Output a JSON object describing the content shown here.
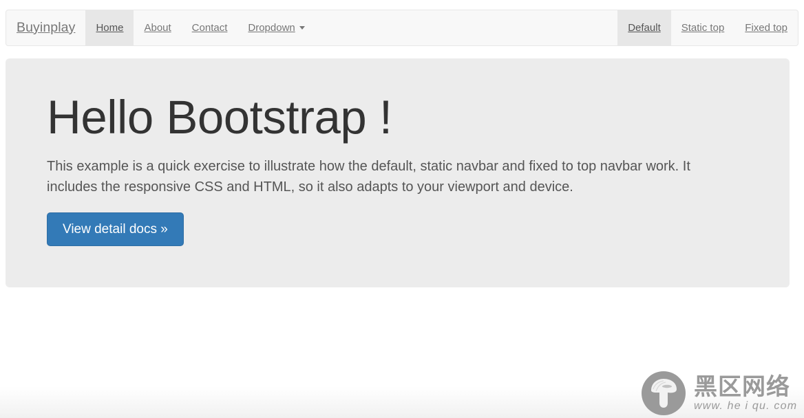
{
  "navbar": {
    "brand": "Buyinplay",
    "left_items": [
      {
        "label": "Home",
        "active": true,
        "caret": false
      },
      {
        "label": "About",
        "active": false,
        "caret": false
      },
      {
        "label": "Contact",
        "active": false,
        "caret": false
      },
      {
        "label": "Dropdown",
        "active": false,
        "caret": true
      }
    ],
    "right_items": [
      {
        "label": "Default",
        "active": true
      },
      {
        "label": "Static top",
        "active": false
      },
      {
        "label": "Fixed top",
        "active": false
      }
    ]
  },
  "jumbotron": {
    "heading": "Hello Bootstrap !",
    "paragraph": "This example is a quick exercise to illustrate how the default, static navbar and fixed to top navbar work. It includes the responsive CSS and HTML, so it also adapts to your viewport and device.",
    "cta_label": "View detail docs »"
  },
  "watermark": {
    "chinese": "黑区网络",
    "url": "www. he i qu. com"
  },
  "colors": {
    "navbar_bg": "#f8f8f8",
    "navbar_border": "#e7e7e7",
    "nav_active_bg": "#e7e7e7",
    "nav_link": "#777777",
    "jumbotron_bg": "#ececec",
    "heading": "#333333",
    "body_text": "#555555",
    "primary": "#337ab7",
    "primary_border": "#2e6da4",
    "watermark": "#9a9a9a"
  }
}
